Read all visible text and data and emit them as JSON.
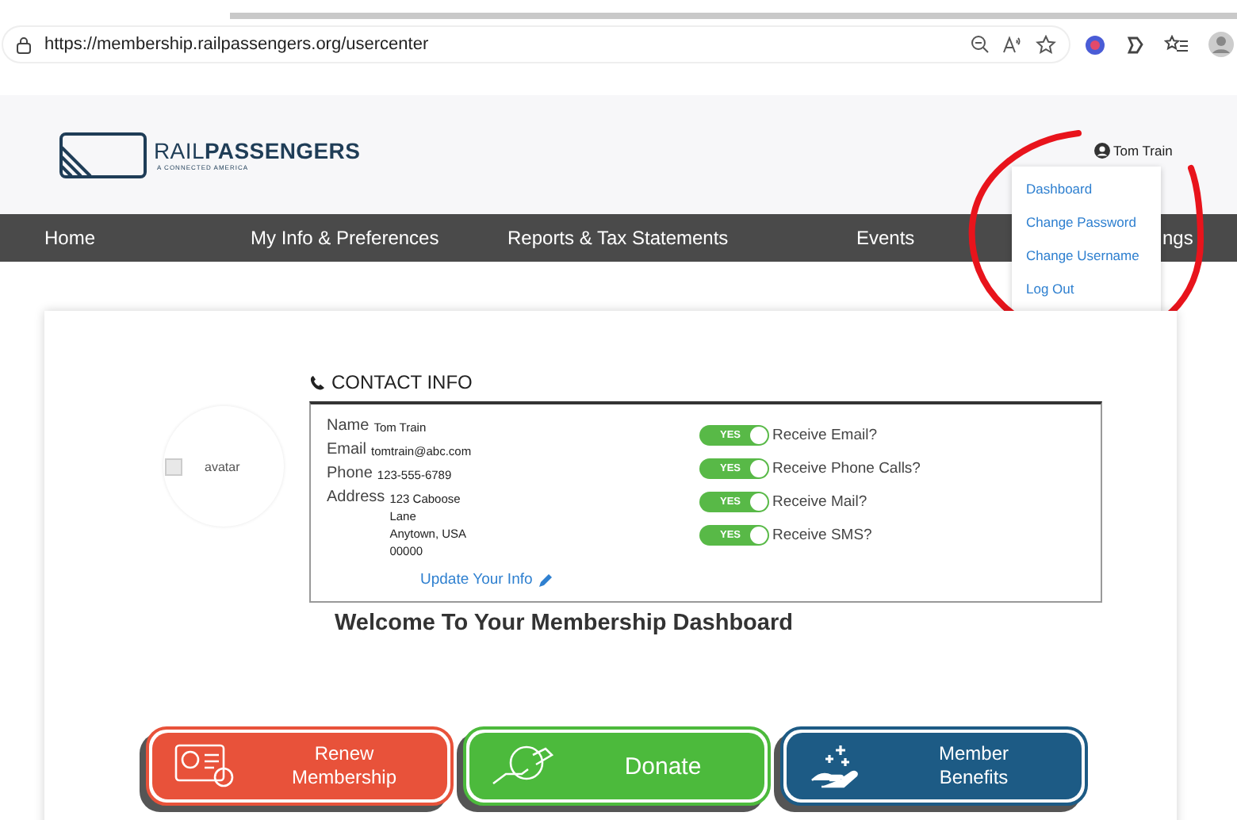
{
  "browser": {
    "url": "https://membership.railpassengers.org/usercenter"
  },
  "header": {
    "logo": {
      "name": "RAIL**PASSENGERS**",
      "tagline": "A CONNECTED AMERICA"
    },
    "user": "Tom Train",
    "nav": [
      {
        "label": "Home"
      },
      {
        "label": "My Info & Preferences"
      },
      {
        "label": "Reports & Tax Statements"
      },
      {
        "label": "Events"
      },
      {
        "label": "ngs"
      }
    ],
    "user_menu": [
      {
        "label": "Dashboard"
      },
      {
        "label": "Change Password"
      },
      {
        "label": "Change Username"
      },
      {
        "label": "Log Out"
      }
    ]
  },
  "profile": {
    "avatar_alt": "avatar"
  },
  "contact": {
    "title": "CONTACT INFO",
    "fields": [
      {
        "label": "Name",
        "lines": [
          "Tom Train"
        ]
      },
      {
        "label": "Email",
        "lines": [
          "tomtrain@abc.com"
        ]
      },
      {
        "label": "Phone",
        "lines": [
          "123-555-6789"
        ]
      },
      {
        "label": "Address",
        "lines": [
          "123 Caboose",
          "Lane",
          "Anytown, USA",
          "00000"
        ]
      }
    ],
    "update_link": "Update Your Info",
    "preferences": [
      {
        "label": "Receive Email?",
        "toggle": "YES",
        "on": true
      },
      {
        "label": "Receive Phone Calls?",
        "toggle": "YES",
        "on": true
      },
      {
        "label": "Receive Mail?",
        "toggle": "YES",
        "on": true
      },
      {
        "label": "Receive SMS?",
        "toggle": "YES",
        "on": true
      }
    ]
  },
  "welcome": "Welcome To Your Membership Dashboard",
  "actions": [
    {
      "label": "Renew Membership",
      "kind": "card",
      "color": "#e8523a"
    },
    {
      "label": "Donate",
      "kind": "donate",
      "color": "#4cba3c"
    },
    {
      "label": "Member Benefits",
      "kind": "benefits",
      "color": "#1d5b85"
    }
  ]
}
